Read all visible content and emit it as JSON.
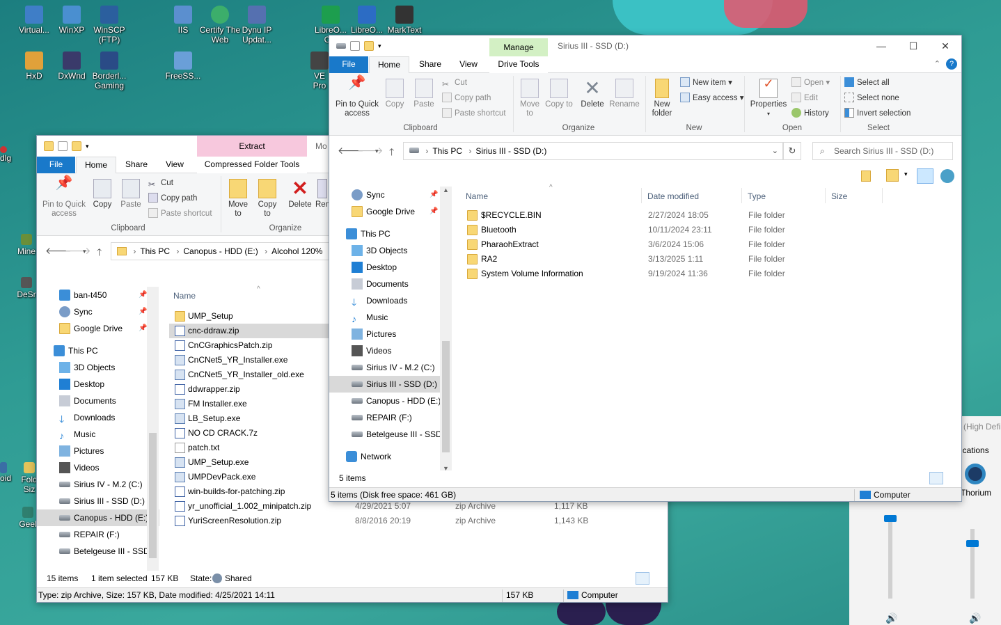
{
  "desktop": {
    "icons": [
      {
        "label": "Virtual..."
      },
      {
        "label": "WinXP"
      },
      {
        "label": "WinSCP (FTP)"
      },
      {
        "label": "IIS"
      },
      {
        "label": "Certify The Web"
      },
      {
        "label": "Dynu IP Updat..."
      },
      {
        "label": "LibreO... C..."
      },
      {
        "label": "LibreO..."
      },
      {
        "label": "MarkText"
      },
      {
        "label": "HxD"
      },
      {
        "label": "DxWnd"
      },
      {
        "label": "Borderl... Gaming"
      },
      {
        "label": "FreeSS..."
      },
      {
        "label": "VE Pro"
      },
      {
        "label": "dlg"
      },
      {
        "label": "Mine"
      },
      {
        "label": "DeSr"
      },
      {
        "label": "oid"
      },
      {
        "label": "Fold Siz"
      },
      {
        "label": "Geel"
      }
    ],
    "side_panel": {
      "hint_text": "(High Defi",
      "notif_text": "ications",
      "thorium_label": "Thorium"
    }
  },
  "back_window": {
    "ribbon_tabs": {
      "file": "File",
      "home": "Home",
      "share": "Share",
      "view": "View",
      "context_group": "Extract",
      "context_tab": "Compressed Folder Tools",
      "cut_off": "Mo"
    },
    "clipboard": {
      "pin": "Pin to Quick access",
      "copy": "Copy",
      "paste": "Paste",
      "cut": "Cut",
      "copy_path": "Copy path",
      "paste_shortcut": "Paste shortcut",
      "group": "Clipboard"
    },
    "organize": {
      "move_to": "Move to",
      "copy_to": "Copy to",
      "delete": "Delete",
      "rename_cut": "Ren",
      "group": "Organize"
    },
    "breadcrumb": [
      "This PC",
      "Canopus - HDD (E:)",
      "Alcohol 120%"
    ],
    "nav": [
      {
        "label": "ban-t450",
        "pinned": true
      },
      {
        "label": "Sync",
        "pinned": true
      },
      {
        "label": "Google Drive",
        "pinned": true
      },
      {
        "label": "This PC"
      },
      {
        "label": "3D Objects"
      },
      {
        "label": "Desktop"
      },
      {
        "label": "Documents"
      },
      {
        "label": "Downloads"
      },
      {
        "label": "Music"
      },
      {
        "label": "Pictures"
      },
      {
        "label": "Videos"
      },
      {
        "label": "Sirius IV - M.2 (C:)"
      },
      {
        "label": "Sirius III - SSD (D:)"
      },
      {
        "label": "Canopus - HDD (E:)"
      },
      {
        "label": "REPAIR (F:)"
      },
      {
        "label": "Betelgeuse III - SSD ("
      }
    ],
    "col_name": "Name",
    "files": [
      {
        "name": "UMP_Setup",
        "type": "folder",
        "date": "",
        "ftype": "",
        "size": ""
      },
      {
        "name": "cnc-ddraw.zip",
        "type": "zip",
        "date": "",
        "ftype": "",
        "size": ""
      },
      {
        "name": "CnCGraphicsPatch.zip",
        "type": "zip",
        "date": "",
        "ftype": "",
        "size": ""
      },
      {
        "name": "CnCNet5_YR_Installer.exe",
        "type": "exe",
        "date": "",
        "ftype": "",
        "size": ""
      },
      {
        "name": "CnCNet5_YR_Installer_old.exe",
        "type": "exe",
        "date": "",
        "ftype": "",
        "size": ""
      },
      {
        "name": "ddwrapper.zip",
        "type": "zip",
        "date": "",
        "ftype": "",
        "size": ""
      },
      {
        "name": "FM Installer.exe",
        "type": "exe",
        "date": "",
        "ftype": "",
        "size": ""
      },
      {
        "name": "LB_Setup.exe",
        "type": "exe",
        "date": "",
        "ftype": "",
        "size": ""
      },
      {
        "name": "NO CD CRACK.7z",
        "type": "zip",
        "date": "",
        "ftype": "",
        "size": ""
      },
      {
        "name": "patch.txt",
        "type": "txt",
        "date": "",
        "ftype": "",
        "size": ""
      },
      {
        "name": "UMP_Setup.exe",
        "type": "exe",
        "date": "",
        "ftype": "",
        "size": ""
      },
      {
        "name": "UMPDevPack.exe",
        "type": "exe",
        "date": "",
        "ftype": "",
        "size": ""
      },
      {
        "name": "win-builds-for-patching.zip",
        "type": "zip",
        "date": "",
        "ftype": "",
        "size": ""
      },
      {
        "name": "yr_unofficial_1.002_minipatch.zip",
        "type": "zip",
        "date": "4/29/2021 5:07",
        "ftype": "zip Archive",
        "size": "1,117 KB"
      },
      {
        "name": "YuriScreenResolution.zip",
        "type": "zip",
        "date": "8/8/2016 20:19",
        "ftype": "zip Archive",
        "size": "1,143 KB"
      }
    ],
    "status": {
      "items": "15 items",
      "selected": "1 item selected",
      "size": "157 KB",
      "state_label": "State:",
      "state_value": "Shared"
    },
    "details_bar": {
      "info": "Type: zip Archive, Size: 157 KB, Date modified: 4/25/2021 14:11",
      "size": "157 KB",
      "location": "Computer"
    }
  },
  "front_window": {
    "title": "Sirius III - SSD (D:)",
    "ribbon_tabs": {
      "file": "File",
      "home": "Home",
      "share": "Share",
      "view": "View",
      "context_group": "Manage",
      "context_tab": "Drive Tools"
    },
    "clipboard": {
      "pin": "Pin to Quick access",
      "copy": "Copy",
      "paste": "Paste",
      "cut": "Cut",
      "copy_path": "Copy path",
      "paste_shortcut": "Paste shortcut",
      "group": "Clipboard"
    },
    "organize": {
      "move_to": "Move to",
      "copy_to": "Copy to",
      "delete": "Delete",
      "rename": "Rename",
      "group": "Organize"
    },
    "new": {
      "new_folder": "New folder",
      "new_item": "New item",
      "easy_access": "Easy access",
      "group": "New"
    },
    "open": {
      "properties": "Properties",
      "open": "Open",
      "edit": "Edit",
      "history": "History",
      "group": "Open"
    },
    "select": {
      "select_all": "Select all",
      "select_none": "Select none",
      "invert": "Invert selection",
      "group": "Select"
    },
    "breadcrumb": [
      "This PC",
      "Sirius III - SSD (D:)"
    ],
    "search_placeholder": "Search Sirius III - SSD (D:)",
    "nav": [
      {
        "label": "Sync",
        "pinned": true
      },
      {
        "label": "Google Drive",
        "pinned": true
      },
      {
        "label": "This PC"
      },
      {
        "label": "3D Objects"
      },
      {
        "label": "Desktop"
      },
      {
        "label": "Documents"
      },
      {
        "label": "Downloads"
      },
      {
        "label": "Music"
      },
      {
        "label": "Pictures"
      },
      {
        "label": "Videos"
      },
      {
        "label": "Sirius IV - M.2 (C:)"
      },
      {
        "label": "Sirius III - SSD (D:)"
      },
      {
        "label": "Canopus - HDD (E:)"
      },
      {
        "label": "REPAIR (F:)"
      },
      {
        "label": "Betelgeuse III - SSD ("
      },
      {
        "label": "Network"
      }
    ],
    "columns": {
      "name": "Name",
      "date": "Date modified",
      "type": "Type",
      "size": "Size"
    },
    "files": [
      {
        "name": "$RECYCLE.BIN",
        "date": "2/27/2024 18:05",
        "type": "File folder"
      },
      {
        "name": "Bluetooth",
        "date": "10/11/2024 23:11",
        "type": "File folder"
      },
      {
        "name": "PharaohExtract",
        "date": "3/6/2024 15:06",
        "type": "File folder"
      },
      {
        "name": "RA2",
        "date": "3/13/2025 1:11",
        "type": "File folder"
      },
      {
        "name": "System Volume Information",
        "date": "9/19/2024 11:36",
        "type": "File folder"
      }
    ],
    "status": {
      "items": "5 items"
    },
    "details_bar": {
      "info": "5 items (Disk free space: 461 GB)",
      "location": "Computer"
    }
  },
  "colors": {
    "accent": "#1979ca",
    "select": "#cce8ff",
    "context_pink": "#f7c8dd",
    "context_green": "#d3f0c4"
  }
}
